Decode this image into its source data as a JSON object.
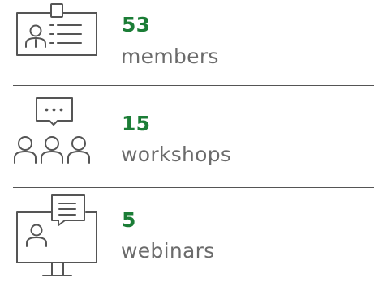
{
  "colors": {
    "accent": "#1b7d36",
    "label": "#6b6b6b",
    "icon": "#555555",
    "divider": "#555555"
  },
  "stats": [
    {
      "value": "53",
      "label": "members",
      "icon": "id-badge-icon"
    },
    {
      "value": "15",
      "label": "workshops",
      "icon": "group-chat-icon"
    },
    {
      "value": "5",
      "label": "webinars",
      "icon": "monitor-presenter-icon"
    }
  ]
}
